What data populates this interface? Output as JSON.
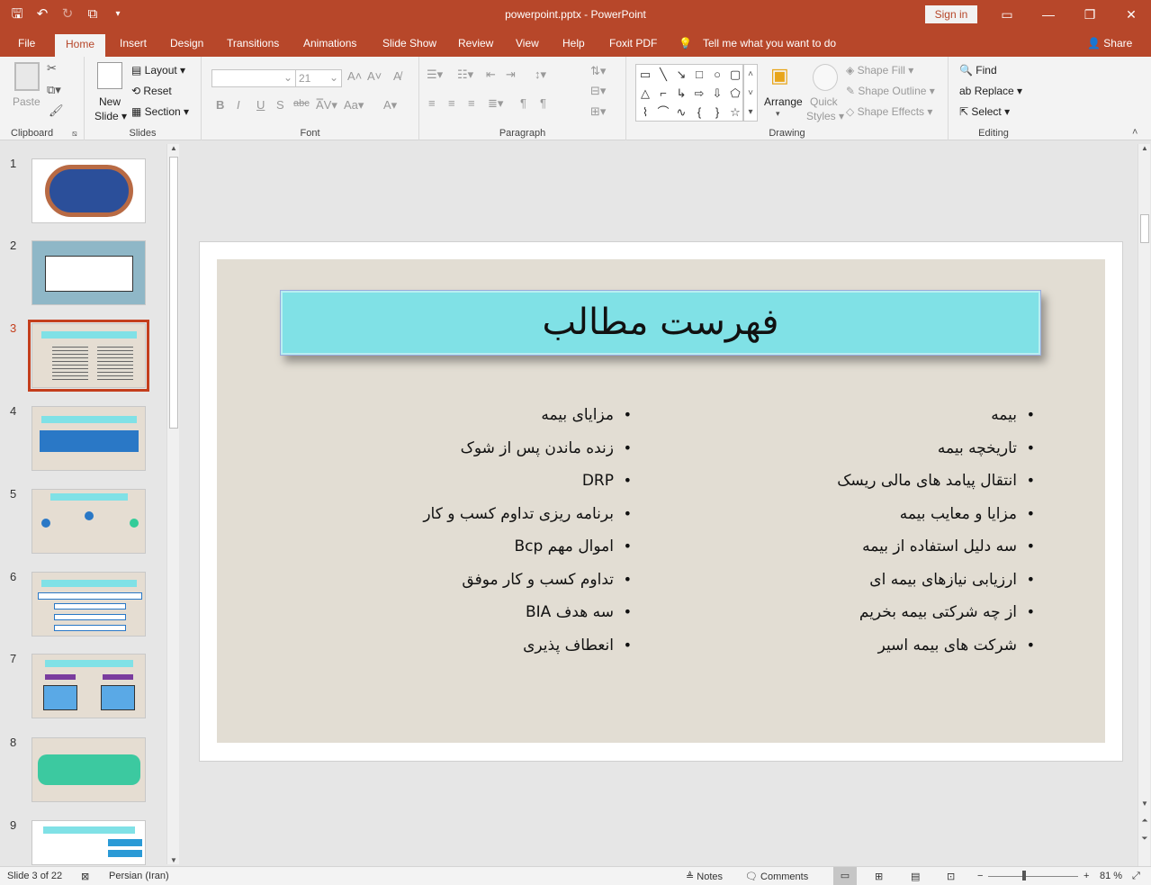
{
  "window": {
    "title": "powerpoint.pptx  -  PowerPoint",
    "sign_in": "Sign in"
  },
  "colors": {
    "accent": "#b7472a",
    "slide_title_fill": "#80e1e6",
    "slide_bg": "#e2ddd3",
    "selection": "#c43e1c"
  },
  "tabs": [
    "File",
    "Home",
    "Insert",
    "Design",
    "Transitions",
    "Animations",
    "Slide Show",
    "Review",
    "View",
    "Help",
    "Foxit PDF"
  ],
  "tell_me": "Tell me what you want to do",
  "share": "Share",
  "ribbon": {
    "clipboard": {
      "label": "Clipboard",
      "paste": "Paste"
    },
    "slides": {
      "label": "Slides",
      "new_slide_1": "New",
      "new_slide_2": "Slide",
      "layout": "Layout",
      "reset": "Reset",
      "section": "Section"
    },
    "font": {
      "label": "Font",
      "size": "21"
    },
    "paragraph": {
      "label": "Paragraph"
    },
    "drawing": {
      "label": "Drawing",
      "arrange": "Arrange",
      "quick_styles_1": "Quick",
      "quick_styles_2": "Styles",
      "shape_fill": "Shape Fill",
      "shape_outline": "Shape Outline",
      "shape_effects": "Shape Effects"
    },
    "editing": {
      "label": "Editing",
      "find": "Find",
      "replace": "Replace",
      "select": "Select"
    }
  },
  "thumbnails": [
    "1",
    "2",
    "3",
    "4",
    "5",
    "6",
    "7",
    "8",
    "9"
  ],
  "selected_slide": 3,
  "slide": {
    "title": "فهرست مطالب",
    "right_column": [
      "بیمه",
      "تاریخچه بیمه",
      "انتقال پیامد های مالی ریسک",
      "مزایا و معایب بیمه",
      "سه دلیل استفاده از بیمه",
      "ارزیابی نیازهای بیمه ای",
      "از چه شرکتی بیمه بخریم",
      "شرکت های بیمه اسیر"
    ],
    "left_column": [
      "مزایای بیمه",
      "زنده ماندن پس از شوک",
      "DRP",
      "برنامه ریزی تداوم کسب و کار",
      "اموال مهم Bcp",
      "تداوم کسب و کار موفق",
      "سه هدف BIA",
      "انعطاف پذیری"
    ]
  },
  "status": {
    "slide_of": "Slide 3 of 22",
    "language": "Persian (Iran)",
    "notes": "Notes",
    "comments": "Comments",
    "zoom": "81 %"
  }
}
